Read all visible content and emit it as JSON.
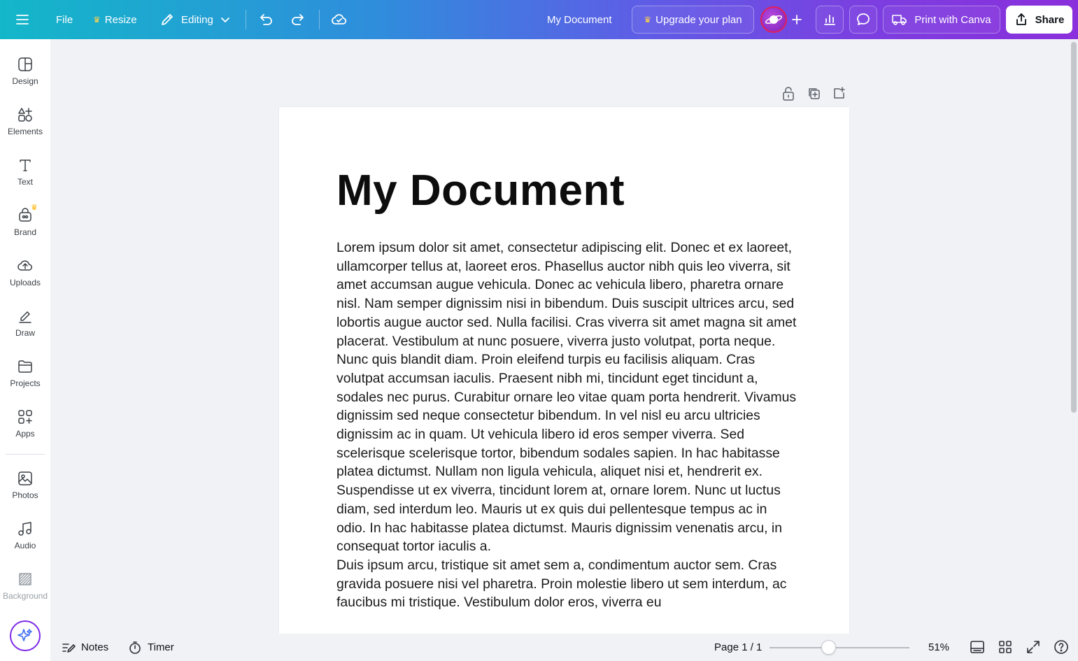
{
  "topbar": {
    "file_label": "File",
    "resize_label": "Resize",
    "editing_label": "Editing",
    "document_title": "My Document",
    "upgrade_label": "Upgrade your plan",
    "print_label": "Print with Canva",
    "share_label": "Share"
  },
  "sidebar": {
    "items": [
      {
        "label": "Design",
        "icon": "design-icon"
      },
      {
        "label": "Elements",
        "icon": "elements-icon"
      },
      {
        "label": "Text",
        "icon": "text-icon"
      },
      {
        "label": "Brand",
        "icon": "brand-icon"
      },
      {
        "label": "Uploads",
        "icon": "uploads-icon"
      },
      {
        "label": "Draw",
        "icon": "draw-icon"
      },
      {
        "label": "Projects",
        "icon": "projects-icon"
      },
      {
        "label": "Apps",
        "icon": "apps-icon"
      },
      {
        "label": "Photos",
        "icon": "photos-icon"
      },
      {
        "label": "Audio",
        "icon": "audio-icon"
      },
      {
        "label": "Background",
        "icon": "background-icon"
      }
    ]
  },
  "document": {
    "title": "My Document",
    "paragraphs": [
      "Lorem ipsum dolor sit amet, consectetur adipiscing elit. Donec et ex laoreet, ullamcorper tellus at, laoreet eros. Phasellus auctor nibh quis leo viverra, sit amet accumsan augue vehicula. Donec ac vehicula libero, pharetra ornare nisl. Nam semper dignissim nisi in bibendum. Duis suscipit ultrices arcu, sed lobortis augue auctor sed. Nulla facilisi. Cras viverra sit amet magna sit amet placerat. Vestibulum at nunc posuere, viverra justo volutpat, porta neque.",
      "Nunc quis blandit diam. Proin eleifend turpis eu facilisis aliquam. Cras volutpat accumsan iaculis. Praesent nibh mi, tincidunt eget tincidunt a, sodales nec purus. Curabitur ornare leo vitae quam porta hendrerit. Vivamus dignissim sed neque consectetur bibendum. In vel nisl eu arcu ultricies dignissim ac in quam. Ut vehicula libero id eros semper viverra. Sed scelerisque scelerisque tortor, bibendum sodales sapien. In hac habitasse platea dictumst. Nullam non ligula vehicula, aliquet nisi et, hendrerit ex. Suspendisse ut ex viverra, tincidunt lorem at, ornare lorem. Nunc ut luctus diam, sed interdum leo. Mauris ut ex quis dui pellentesque tempus ac in odio. In hac habitasse platea dictumst. Mauris dignissim venenatis arcu, in consequat tortor iaculis a.",
      "Duis ipsum arcu, tristique sit amet sem a, condimentum auctor sem. Cras gravida posuere nisi vel pharetra. Proin molestie libero ut sem interdum, ac faucibus mi tristique. Vestibulum dolor eros, viverra eu"
    ]
  },
  "bottombar": {
    "notes_label": "Notes",
    "timer_label": "Timer",
    "page_indicator": "Page 1 / 1",
    "zoom_level": "51%",
    "zoom_fraction": 0.42
  },
  "colors": {
    "accent_purple": "#7d2ae8",
    "crown_gold": "#ffb400"
  }
}
